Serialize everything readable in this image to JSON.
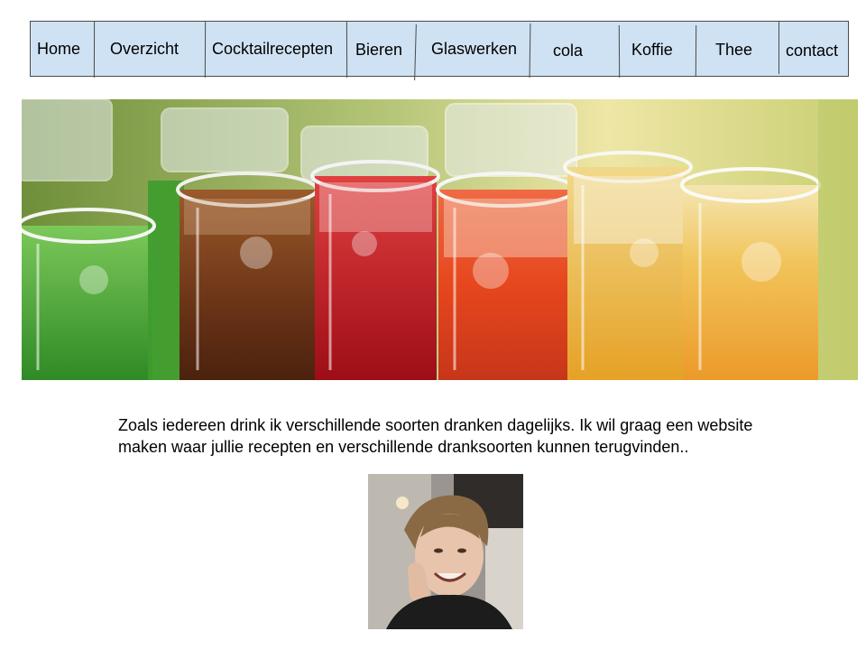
{
  "nav": {
    "items": [
      {
        "label": "Home"
      },
      {
        "label": "Overzicht"
      },
      {
        "label": "Cocktailrecepten"
      },
      {
        "label": "Bieren"
      },
      {
        "label": "Glaswerken"
      },
      {
        "label": "cola"
      },
      {
        "label": "Koffie"
      },
      {
        "label": "Thee"
      },
      {
        "label": "contact"
      }
    ],
    "background": "#cfe2f3",
    "border_color": "#4a4a4a"
  },
  "hero": {
    "icon": "drinks-photo",
    "drink_colors": [
      "#3f9a2a",
      "#7a3d1a",
      "#c0161f",
      "#e44b1e",
      "#e8a21c",
      "#f0b632"
    ]
  },
  "intro": {
    "text": "Zoals iedereen drink ik verschillende soorten dranken dagelijks. Ik wil graag een website maken waar jullie recepten en verschillende dranksoorten kunnen terugvinden.."
  },
  "profile": {
    "icon": "profile-photo"
  }
}
